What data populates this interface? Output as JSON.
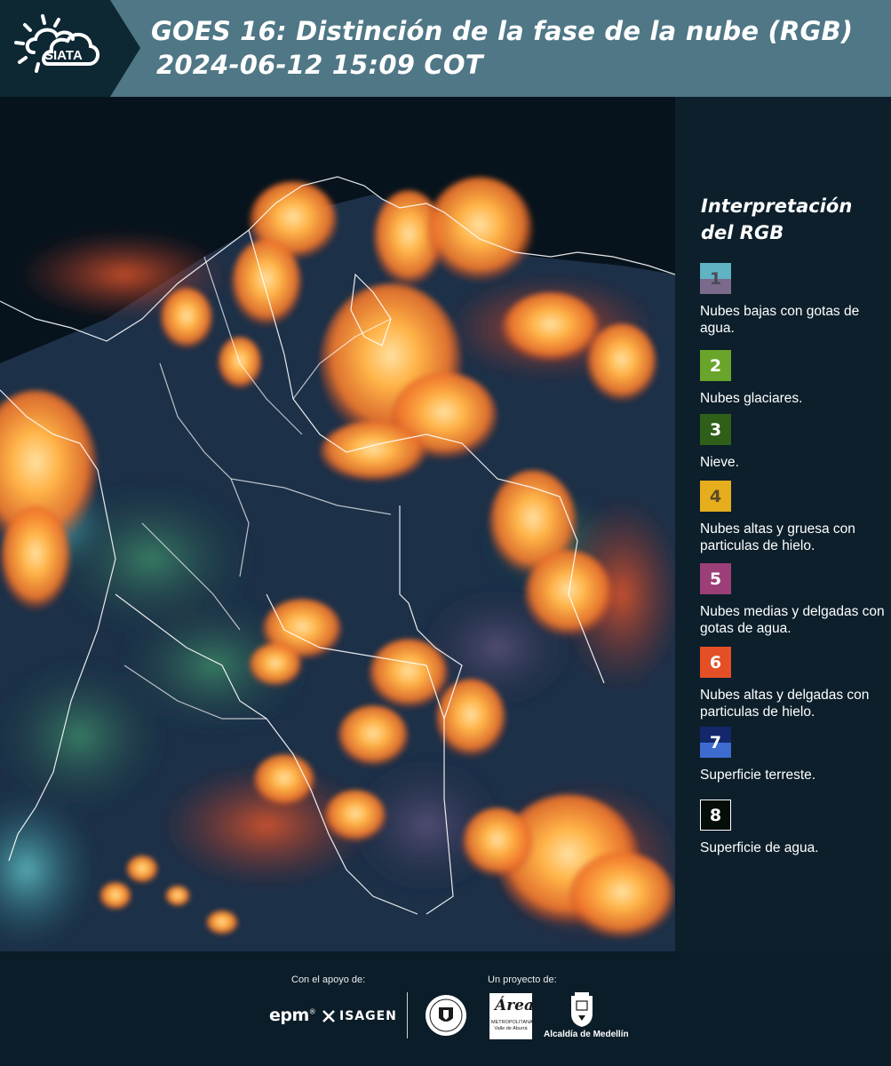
{
  "header": {
    "logo_text": "SIATA",
    "title": "GOES 16: Distinción de la fase de la nube (RGB)",
    "datetime": "2024-06-12 15:09 COT"
  },
  "legend": {
    "title": "Interpretación del RGB",
    "items": [
      {
        "number": "1",
        "label": "Nubes bajas con gotas de agua.",
        "color_top": "#5fb3c2",
        "color_bottom": "#7b6a8c",
        "num_color": "#4a4a5a"
      },
      {
        "number": "2",
        "label": "Nubes glaciares.",
        "color_top": "#6aa52b",
        "color_bottom": "#6aa52b",
        "num_color": "#ffffff"
      },
      {
        "number": "3",
        "label": "Nieve.",
        "color_top": "#2f5f18",
        "color_bottom": "#2f5f18",
        "num_color": "#ffffff"
      },
      {
        "number": "4",
        "label": "Nubes altas y gruesa con particulas de hielo.",
        "color_top": "#e6ae1c",
        "color_bottom": "#e6ae1c",
        "num_color": "#5a4a2a"
      },
      {
        "number": "5",
        "label": "Nubes medias y delgadas con gotas de agua.",
        "color_top": "#9c3f78",
        "color_bottom": "#9c3f78",
        "num_color": "#ffffff"
      },
      {
        "number": "6",
        "label": "Nubes altas y delgadas con particulas de hielo.",
        "color_top": "#e54f26",
        "color_bottom": "#e54f26",
        "num_color": "#ffffff"
      },
      {
        "number": "7",
        "label": "Superficie terreste.",
        "color_top": "#13276b",
        "color_bottom": "#3e6bd0",
        "num_color": "#ffffff"
      },
      {
        "number": "8",
        "label": "Superficie de agua.",
        "color_top": "#050e08",
        "color_bottom": "#050e08",
        "num_color": "#ffffff"
      }
    ]
  },
  "footer": {
    "support_label": "Con el apoyo de:",
    "project_label": "Un proyecto de:",
    "sponsor_epm": "epm",
    "sponsor_isagen": "ISAGEN",
    "area_logo_script": "Área",
    "area_logo_sub": "METROPOLITANA Valle de Aburrá",
    "alcaldia_label": "Alcaldía de Medellín"
  },
  "colors": {
    "header_bg": "#4f7786",
    "logo_bg": "#0d2733",
    "panel_bg": "#0c1f2b",
    "cloud_ice": "#ffa23a",
    "cloud_thin_ice": "#e8582a",
    "land_surface": "#1c3048",
    "water_surface": "#07131c"
  }
}
